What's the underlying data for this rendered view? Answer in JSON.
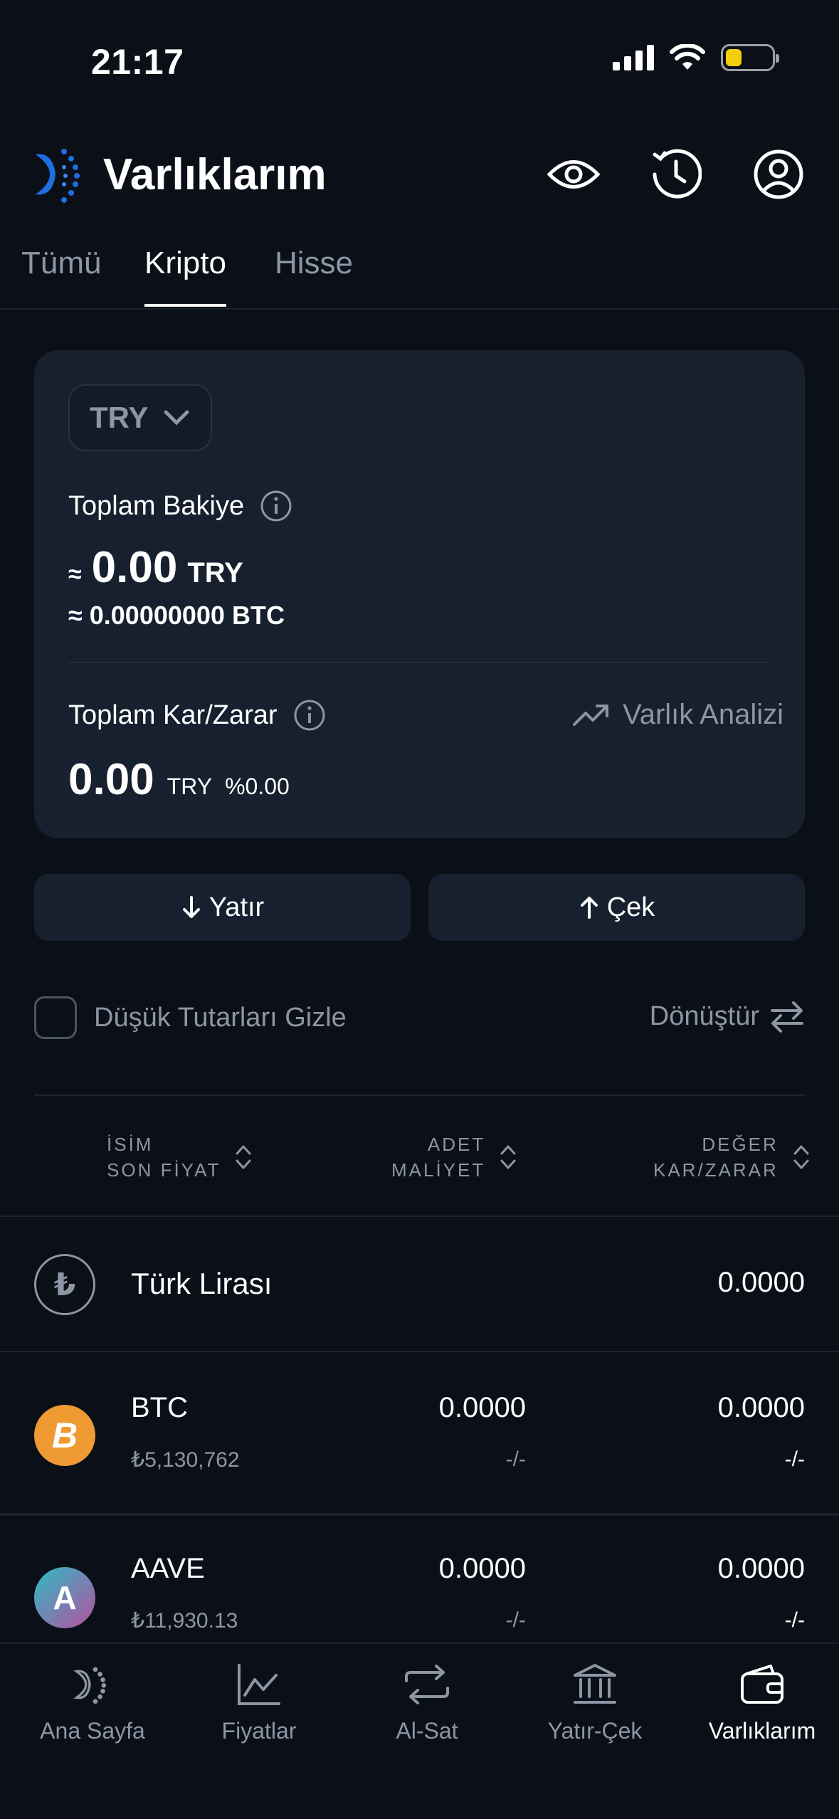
{
  "status_bar": {
    "time": "21:17"
  },
  "header": {
    "title": "Varlıklarım"
  },
  "tabs": [
    {
      "label": "Tümü"
    },
    {
      "label": "Kripto"
    },
    {
      "label": "Hisse"
    }
  ],
  "card": {
    "currency": "TRY",
    "total_balance_label": "Toplam Bakiye",
    "approx_symbol": "≈",
    "balance_value": "0.00",
    "balance_unit": "TRY",
    "btc_line": "≈ 0.00000000 BTC",
    "pl_label": "Toplam Kar/Zarar",
    "analysis_link": "Varlık Analizi",
    "pl_value": "0.00",
    "pl_unit": "TRY",
    "pl_percent": "%0.00"
  },
  "actions": {
    "deposit": "Yatır",
    "withdraw": "Çek"
  },
  "filter": {
    "hide_small": "Düşük Tutarları Gizle",
    "convert": "Dönüştür"
  },
  "table": {
    "col1_line1": "İSİM",
    "col1_line2": "SON FİYAT",
    "col2_line1": "ADET",
    "col2_line2": "MALİYET",
    "col3_line1": "DEĞER",
    "col3_line2": "KAR/ZARAR"
  },
  "rows": [
    {
      "name": "Türk Lirası",
      "symbol": "₺",
      "value": "0.0000"
    },
    {
      "name": "BTC",
      "symbol": "B",
      "price": "₺5,130,762",
      "amount": "0.0000",
      "cost": "-/-",
      "value": "0.0000",
      "pl": "-/-"
    },
    {
      "name": "AAVE",
      "symbol": "A",
      "price": "₺11,930.13",
      "amount": "0.0000",
      "cost": "-/-",
      "value": "0.0000",
      "pl": "-/-"
    }
  ],
  "nav": [
    {
      "label": "Ana Sayfa"
    },
    {
      "label": "Fiyatlar"
    },
    {
      "label": "Al-Sat"
    },
    {
      "label": "Yatır-Çek"
    },
    {
      "label": "Varlıklarım"
    }
  ],
  "colors": {
    "background": "#0b0f17",
    "card": "#16202e",
    "muted_text": "#8c96a5",
    "btc_orange": "#f09a33",
    "battery_yellow": "#f4d00a",
    "brand_blue": "#1f6fe0"
  }
}
